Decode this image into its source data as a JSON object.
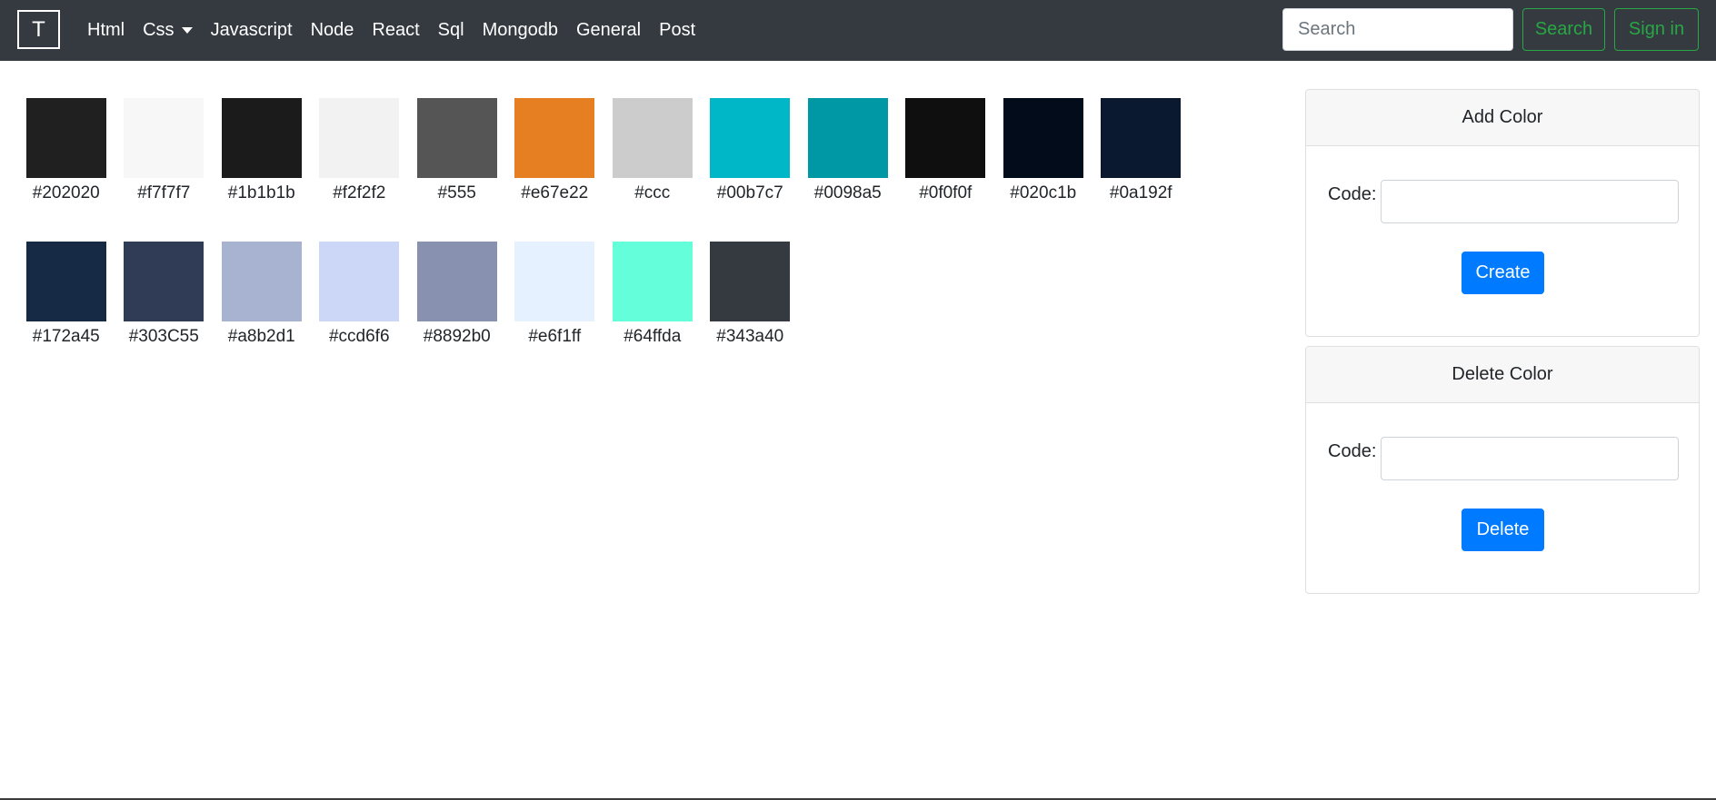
{
  "navbar": {
    "brand": "T",
    "links": [
      {
        "label": "Html",
        "dropdown": false
      },
      {
        "label": "Css",
        "dropdown": true
      },
      {
        "label": "Javascript",
        "dropdown": false
      },
      {
        "label": "Node",
        "dropdown": false
      },
      {
        "label": "React",
        "dropdown": false
      },
      {
        "label": "Sql",
        "dropdown": false
      },
      {
        "label": "Mongodb",
        "dropdown": false
      },
      {
        "label": "General",
        "dropdown": false
      },
      {
        "label": "Post",
        "dropdown": false
      }
    ],
    "search_placeholder": "Search",
    "search_button": "Search",
    "signin_button": "Sign in"
  },
  "swatches": [
    {
      "label": "#202020",
      "color": "#202020"
    },
    {
      "label": "#f7f7f7",
      "color": "#f7f7f7"
    },
    {
      "label": "#1b1b1b",
      "color": "#1b1b1b"
    },
    {
      "label": "#f2f2f2",
      "color": "#f2f2f2"
    },
    {
      "label": "#555",
      "color": "#555555"
    },
    {
      "label": "#e67e22",
      "color": "#e67e22"
    },
    {
      "label": "#ccc",
      "color": "#cccccc"
    },
    {
      "label": "#00b7c7",
      "color": "#00b7c7"
    },
    {
      "label": "#0098a5",
      "color": "#0098a5"
    },
    {
      "label": "#0f0f0f",
      "color": "#0f0f0f"
    },
    {
      "label": "#020c1b",
      "color": "#020c1b"
    },
    {
      "label": "#0a192f",
      "color": "#0a192f"
    },
    {
      "label": "#172a45",
      "color": "#172a45"
    },
    {
      "label": "#303C55",
      "color": "#303c55"
    },
    {
      "label": "#a8b2d1",
      "color": "#a8b2d1"
    },
    {
      "label": "#ccd6f6",
      "color": "#ccd6f6"
    },
    {
      "label": "#8892b0",
      "color": "#8892b0"
    },
    {
      "label": "#e6f1ff",
      "color": "#e6f1ff"
    },
    {
      "label": "#64ffda",
      "color": "#64ffda"
    },
    {
      "label": "#343a40",
      "color": "#343a40"
    }
  ],
  "add_card": {
    "title": "Add Color",
    "code_label": "Code:",
    "code_value": "",
    "button": "Create"
  },
  "delete_card": {
    "title": "Delete Color",
    "code_label": "Code:",
    "code_value": "",
    "button": "Delete"
  },
  "colors": {
    "navbar_bg": "#343a40",
    "success": "#28a745",
    "primary": "#007bff"
  }
}
